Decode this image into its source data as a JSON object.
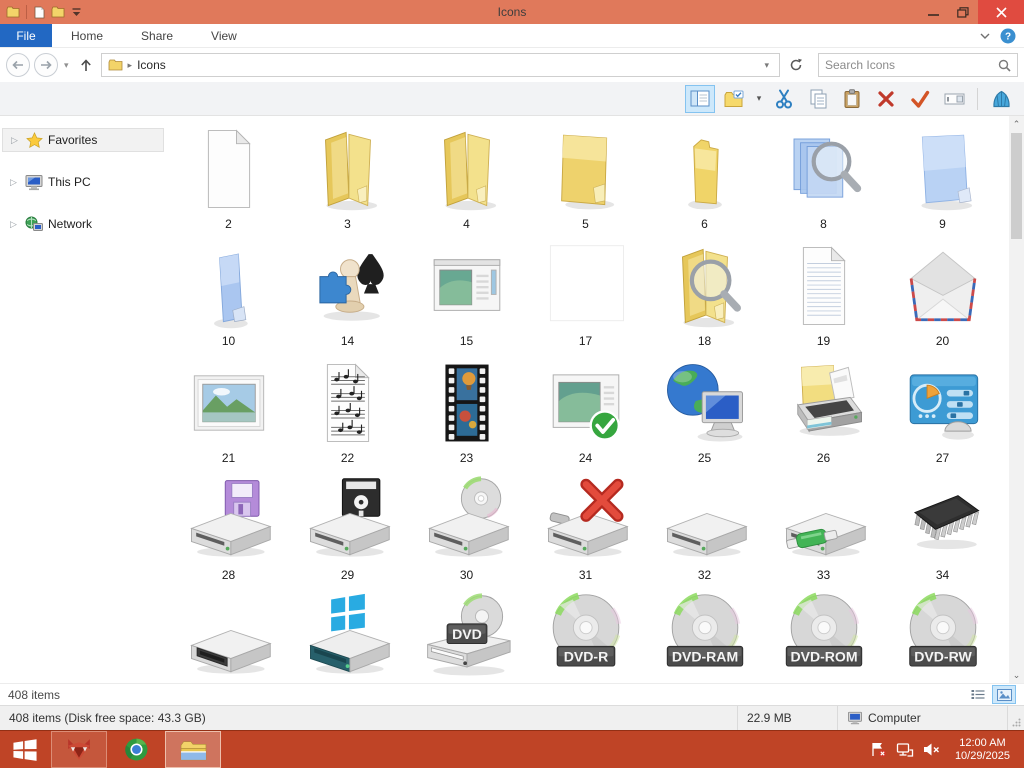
{
  "colors": {
    "titlebar": "#e0795b",
    "taskbar": "#bf4426",
    "close_button": "#e04b40",
    "file_tab_blue": "#2268c3",
    "selection_fill": "#cde8fb",
    "selection_border": "#84c3f0"
  },
  "window": {
    "title": "Icons",
    "qat_icons": [
      "explorer-app-icon",
      "properties-icon",
      "new-folder-icon",
      "customize-qat-caret-icon"
    ],
    "caption_buttons": [
      "minimize",
      "restore",
      "close"
    ]
  },
  "ribbon": {
    "file_tab": "File",
    "tabs": [
      "Home",
      "Share",
      "View"
    ],
    "right_icons": [
      "minimize-ribbon-chevron-icon",
      "help-icon"
    ]
  },
  "address": {
    "path": "Icons",
    "search_placeholder": "Search Icons",
    "nav_icons": [
      "back-icon",
      "forward-icon",
      "recent-caret-icon",
      "up-icon",
      "refresh-icon"
    ]
  },
  "toolbar": {
    "icons": [
      "preview-pane",
      "new-folder",
      "cut",
      "copy",
      "paste",
      "delete",
      "apply-check",
      "rename-field",
      "shell"
    ]
  },
  "sidebar": {
    "items": [
      {
        "label": "Favorites",
        "icon": "star",
        "selected": true
      },
      {
        "label": "This PC",
        "icon": "computer",
        "selected": false
      },
      {
        "label": "Network",
        "icon": "network-globe",
        "selected": false
      }
    ]
  },
  "grid": {
    "items": [
      {
        "label": "2",
        "icon": "document-blank"
      },
      {
        "label": "3",
        "icon": "folder-open"
      },
      {
        "label": "4",
        "icon": "folder-open"
      },
      {
        "label": "5",
        "icon": "folder-open-wide"
      },
      {
        "label": "6",
        "icon": "folder-closed"
      },
      {
        "label": "8",
        "icon": "search-documents-blue"
      },
      {
        "label": "9",
        "icon": "folder-blue"
      },
      {
        "label": "10",
        "icon": "folder-blue-slim"
      },
      {
        "label": "14",
        "icon": "games"
      },
      {
        "label": "15",
        "icon": "window-picture"
      },
      {
        "label": "17",
        "icon": "blank-file"
      },
      {
        "label": "18",
        "icon": "folder-search"
      },
      {
        "label": "19",
        "icon": "document-text"
      },
      {
        "label": "20",
        "icon": "envelope"
      },
      {
        "label": "21",
        "icon": "picture-frame"
      },
      {
        "label": "22",
        "icon": "sheet-music"
      },
      {
        "label": "23",
        "icon": "film-strip"
      },
      {
        "label": "24",
        "icon": "window-check"
      },
      {
        "label": "25",
        "icon": "globe-monitor"
      },
      {
        "label": "26",
        "icon": "folder-printer"
      },
      {
        "label": "27",
        "icon": "control-panel"
      },
      {
        "label": "28",
        "icon": "drive-floppy35"
      },
      {
        "label": "29",
        "icon": "drive-floppy525"
      },
      {
        "label": "30",
        "icon": "drive-cd"
      },
      {
        "label": "31",
        "icon": "drive-error"
      },
      {
        "label": "32",
        "icon": "drive"
      },
      {
        "label": "33",
        "icon": "drive-network"
      },
      {
        "label": "34",
        "icon": "memory-chip"
      },
      {
        "label": "",
        "icon": "drive-removable"
      },
      {
        "label": "",
        "icon": "drive-windows"
      },
      {
        "label": "",
        "icon": "dvd-drive",
        "badge": "DVD"
      },
      {
        "label": "",
        "icon": "dvd-disc",
        "badge": "DVD-R"
      },
      {
        "label": "",
        "icon": "dvd-disc",
        "badge": "DVD-RAM"
      },
      {
        "label": "",
        "icon": "dvd-disc",
        "badge": "DVD-ROM"
      },
      {
        "label": "",
        "icon": "dvd-disc",
        "badge": "DVD-RW"
      }
    ]
  },
  "status": {
    "count": "408 items",
    "free_space": "408 items (Disk free space: 43.3 GB)",
    "selected_size": "22.9 MB",
    "zone": "Computer",
    "view_buttons": [
      "details-view",
      "large-thumbnail-view"
    ]
  },
  "taskbar": {
    "time": "12:00 AM",
    "date": "10/29/2025",
    "buttons": [
      "start",
      "fox-app",
      "browser",
      "file-explorer"
    ],
    "tray_icons": [
      "action-center-flag",
      "network",
      "volume-muted"
    ]
  }
}
